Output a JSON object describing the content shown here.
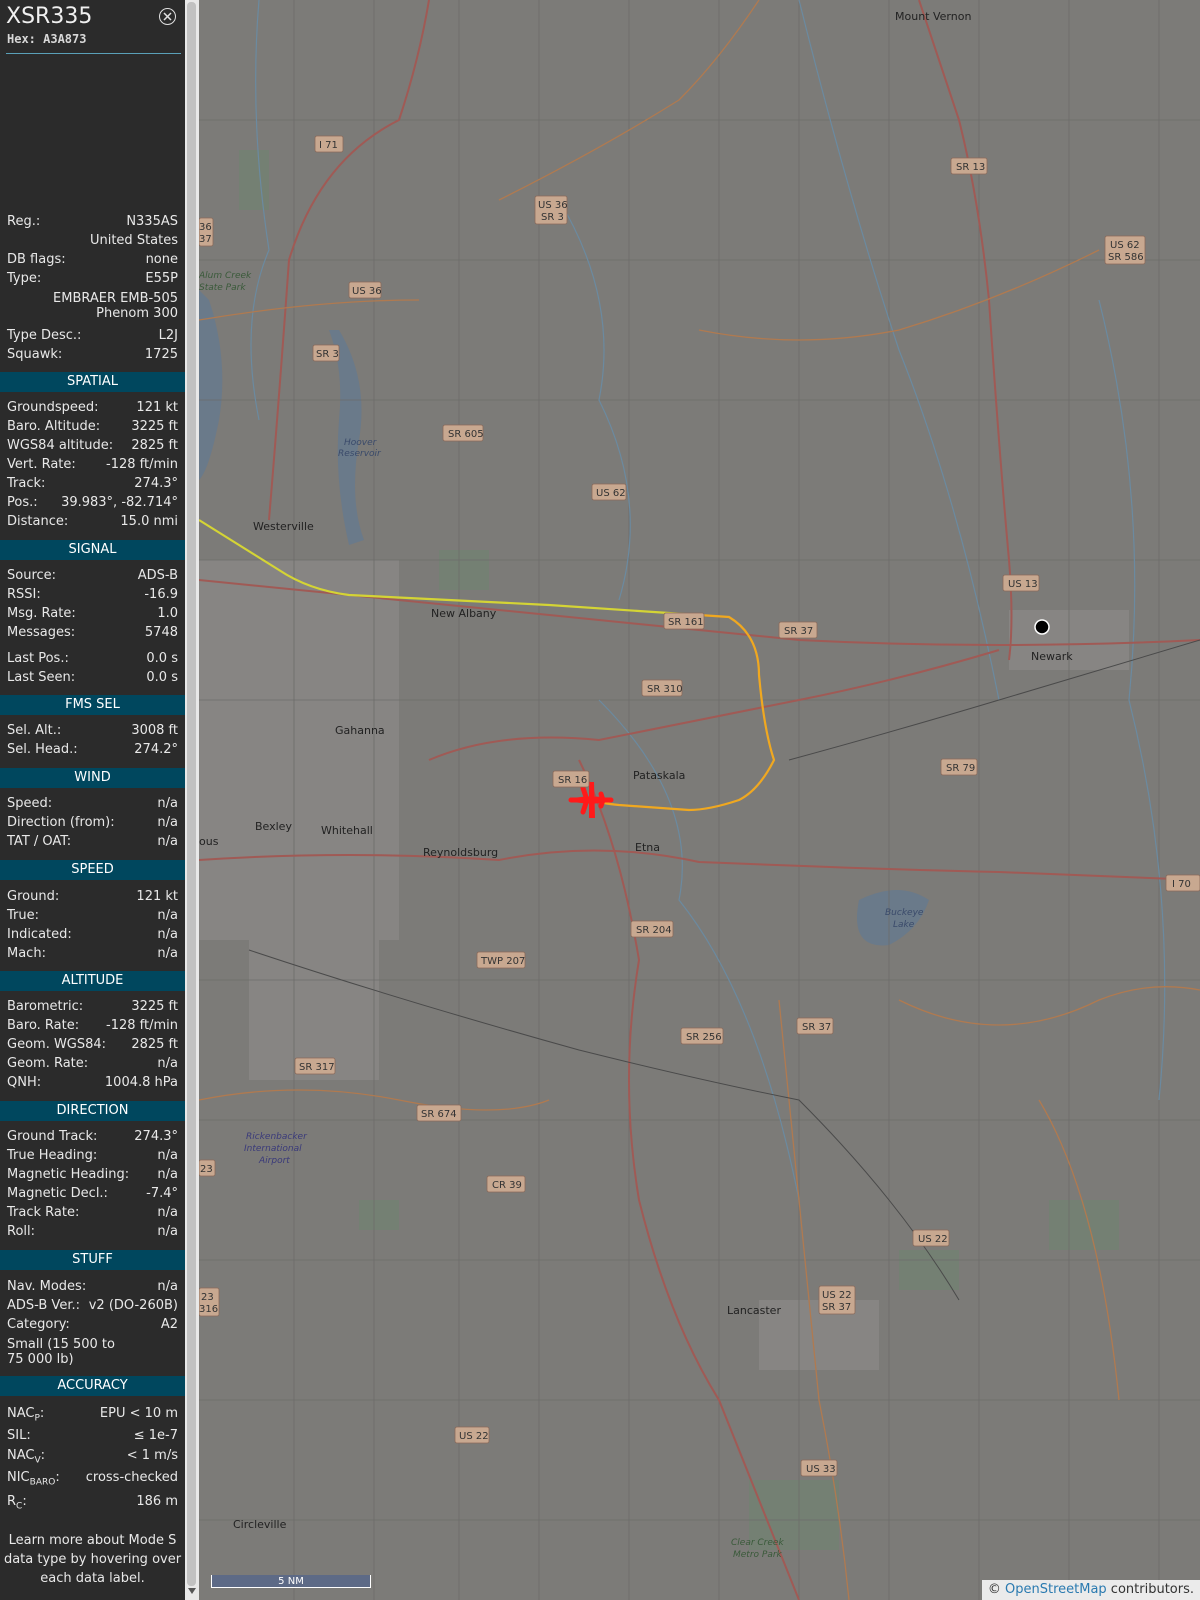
{
  "aircraft": {
    "callsign": "XSR335",
    "hex": "Hex: A3A873"
  },
  "info": {
    "reg_label": "Reg.:",
    "reg": "N335AS",
    "country": "United States",
    "dbflags_label": "DB flags:",
    "dbflags": "none",
    "type_label": "Type:",
    "type": "E55P",
    "type_name_1": "EMBRAER EMB-505",
    "type_name_2": "Phenom 300",
    "typedesc_label": "Type Desc.:",
    "typedesc": "L2J",
    "squawk_label": "Squawk:",
    "squawk": "1725"
  },
  "spatial": {
    "header": "SPATIAL",
    "gs_label": "Groundspeed:",
    "gs": "121 kt",
    "baro_label": "Baro. Altitude:",
    "baro": "3225 ft",
    "wgs_label": "WGS84 altitude:",
    "wgs": "2825 ft",
    "vr_label": "Vert. Rate:",
    "vr": "-128 ft/min",
    "track_label": "Track:",
    "track": "274.3°",
    "pos_label": "Pos.:",
    "pos": "39.983°, -82.714°",
    "dist_label": "Distance:",
    "dist": "15.0 nmi"
  },
  "signal": {
    "header": "SIGNAL",
    "source_label": "Source:",
    "source": "ADS-B",
    "rssi_label": "RSSI:",
    "rssi": "-16.9",
    "msgrate_label": "Msg. Rate:",
    "msgrate": "1.0",
    "messages_label": "Messages:",
    "messages": "5748",
    "lastpos_label": "Last Pos.:",
    "lastpos": "0.0 s",
    "lastseen_label": "Last Seen:",
    "lastseen": "0.0 s"
  },
  "fms": {
    "header": "FMS SEL",
    "selalt_label": "Sel. Alt.:",
    "selalt": "3008 ft",
    "selhead_label": "Sel. Head.:",
    "selhead": "274.2°"
  },
  "wind": {
    "header": "WIND",
    "speed_label": "Speed:",
    "speed": "n/a",
    "dir_label": "Direction (from):",
    "dir": "n/a",
    "tat_label": "TAT / OAT:",
    "tat": "n/a"
  },
  "speed": {
    "header": "SPEED",
    "ground_label": "Ground:",
    "ground": "121 kt",
    "true_label": "True:",
    "true": "n/a",
    "ind_label": "Indicated:",
    "ind": "n/a",
    "mach_label": "Mach:",
    "mach": "n/a"
  },
  "altitude": {
    "header": "ALTITUDE",
    "baro_label": "Barometric:",
    "baro": "3225 ft",
    "barorate_label": "Baro. Rate:",
    "barorate": "-128 ft/min",
    "geom_label": "Geom. WGS84:",
    "geom": "2825 ft",
    "geomrate_label": "Geom. Rate:",
    "geomrate": "n/a",
    "qnh_label": "QNH:",
    "qnh": "1004.8 hPa"
  },
  "direction": {
    "header": "DIRECTION",
    "gt_label": "Ground Track:",
    "gt": "274.3°",
    "th_label": "True Heading:",
    "th": "n/a",
    "mh_label": "Magnetic Heading:",
    "mh": "n/a",
    "md_label": "Magnetic Decl.:",
    "md": "-7.4°",
    "tr_label": "Track Rate:",
    "tr": "n/a",
    "roll_label": "Roll:",
    "roll": "n/a"
  },
  "stuff": {
    "header": "STUFF",
    "nav_label": "Nav. Modes:",
    "nav": "n/a",
    "adsb_label": "ADS-B Ver.:",
    "adsb": "v2 (DO-260B)",
    "cat_label": "Category:",
    "cat": "A2",
    "cat_desc_1": "Small (15 500 to",
    "cat_desc_2": "75 000 lb)"
  },
  "accuracy": {
    "header": "ACCURACY",
    "nacp_label": "NAC",
    "nacp_sub": "P",
    "nacp": "EPU < 10 m",
    "sil_label": "SIL:",
    "sil": "≤ 1e-7",
    "nacv_label": "NAC",
    "nacv_sub": "V",
    "nacv": "< 1 m/s",
    "nicbaro_label": "NIC",
    "nicbaro_sub": "BARO",
    "nicbaro": "cross-checked",
    "rc_label": "R",
    "rc_sub": "C",
    "rc": "186 m",
    "colon": ":"
  },
  "learn": "Learn more about Mode S data type by hovering over each data label.",
  "map": {
    "towns": [
      "Mount Vernon",
      "Westerville",
      "New Albany",
      "Newark",
      "Gahanna",
      "Pataskala",
      "Bexley",
      "Whitehall",
      "Reynoldsburg",
      "Etna",
      "Lancaster",
      "Circleville",
      "ous"
    ],
    "parks": [
      "Alum Creek",
      "State Park",
      "Hoover",
      "Reservoir",
      "Buckeye",
      "Lake",
      "Rickenbacker",
      "International",
      "Airport",
      "Clear Creek",
      "Metro Park"
    ],
    "shields": [
      "I 71",
      "US 36",
      "SR 3",
      "US 36",
      "SR 3",
      "SR 13",
      "US 62",
      "SR 586",
      "SR 605",
      "US 62",
      "SR 161",
      "SR 37",
      "US 13",
      "SR 310",
      "SR 16",
      "SR 79",
      "SR 204",
      "TWP 207",
      "SR 37",
      "SR 256",
      "SR 317",
      "SR 674",
      "CR 39",
      "US 22",
      "US 22",
      "SR 37",
      "US 22",
      "US 33",
      "I 70",
      "36",
      "37",
      "23",
      "23",
      "316"
    ],
    "scale_label": "5 NM",
    "attrib_prefix": "© ",
    "attrib_link": "OpenStreetMap",
    "attrib_suffix": " contributors."
  },
  "colors": {
    "accent": "#00475e",
    "track_yellow": "#d4d435",
    "track_orange": "#f0a820",
    "aircraft": "#ff1a1a"
  }
}
